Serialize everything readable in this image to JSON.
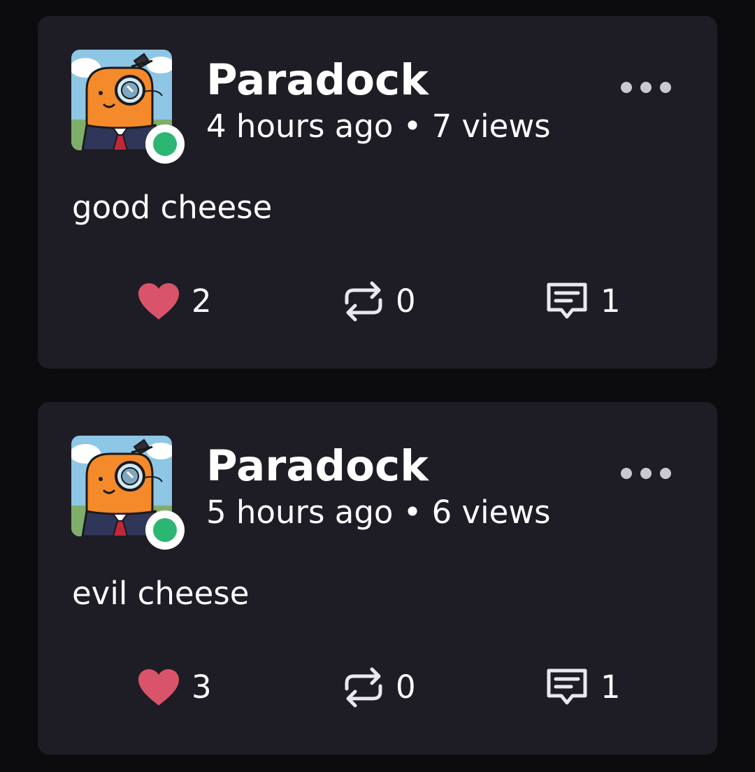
{
  "colors": {
    "page_background": "#0c0c0e",
    "card_background": "#1e1d25",
    "text": "#ffffff",
    "like_heart": "#d9546b",
    "online_status": "#2bb673",
    "icon_stroke": "#e8e8ee"
  },
  "icons": {
    "more": "more-horizontal-icon",
    "like": "heart-icon",
    "repost": "repost-arrows-icon",
    "comment": "speech-bubble-icon",
    "status": "online-status-dot"
  },
  "posts": [
    {
      "author": "Paradock",
      "time": "4 hours ago",
      "separator": "•",
      "views": "7 views",
      "content": "good cheese",
      "likes": "2",
      "reposts": "0",
      "comments": "1"
    },
    {
      "author": "Paradock",
      "time": "5 hours ago",
      "separator": "•",
      "views": "6 views",
      "content": "evil cheese",
      "likes": "3",
      "reposts": "0",
      "comments": "1"
    }
  ]
}
